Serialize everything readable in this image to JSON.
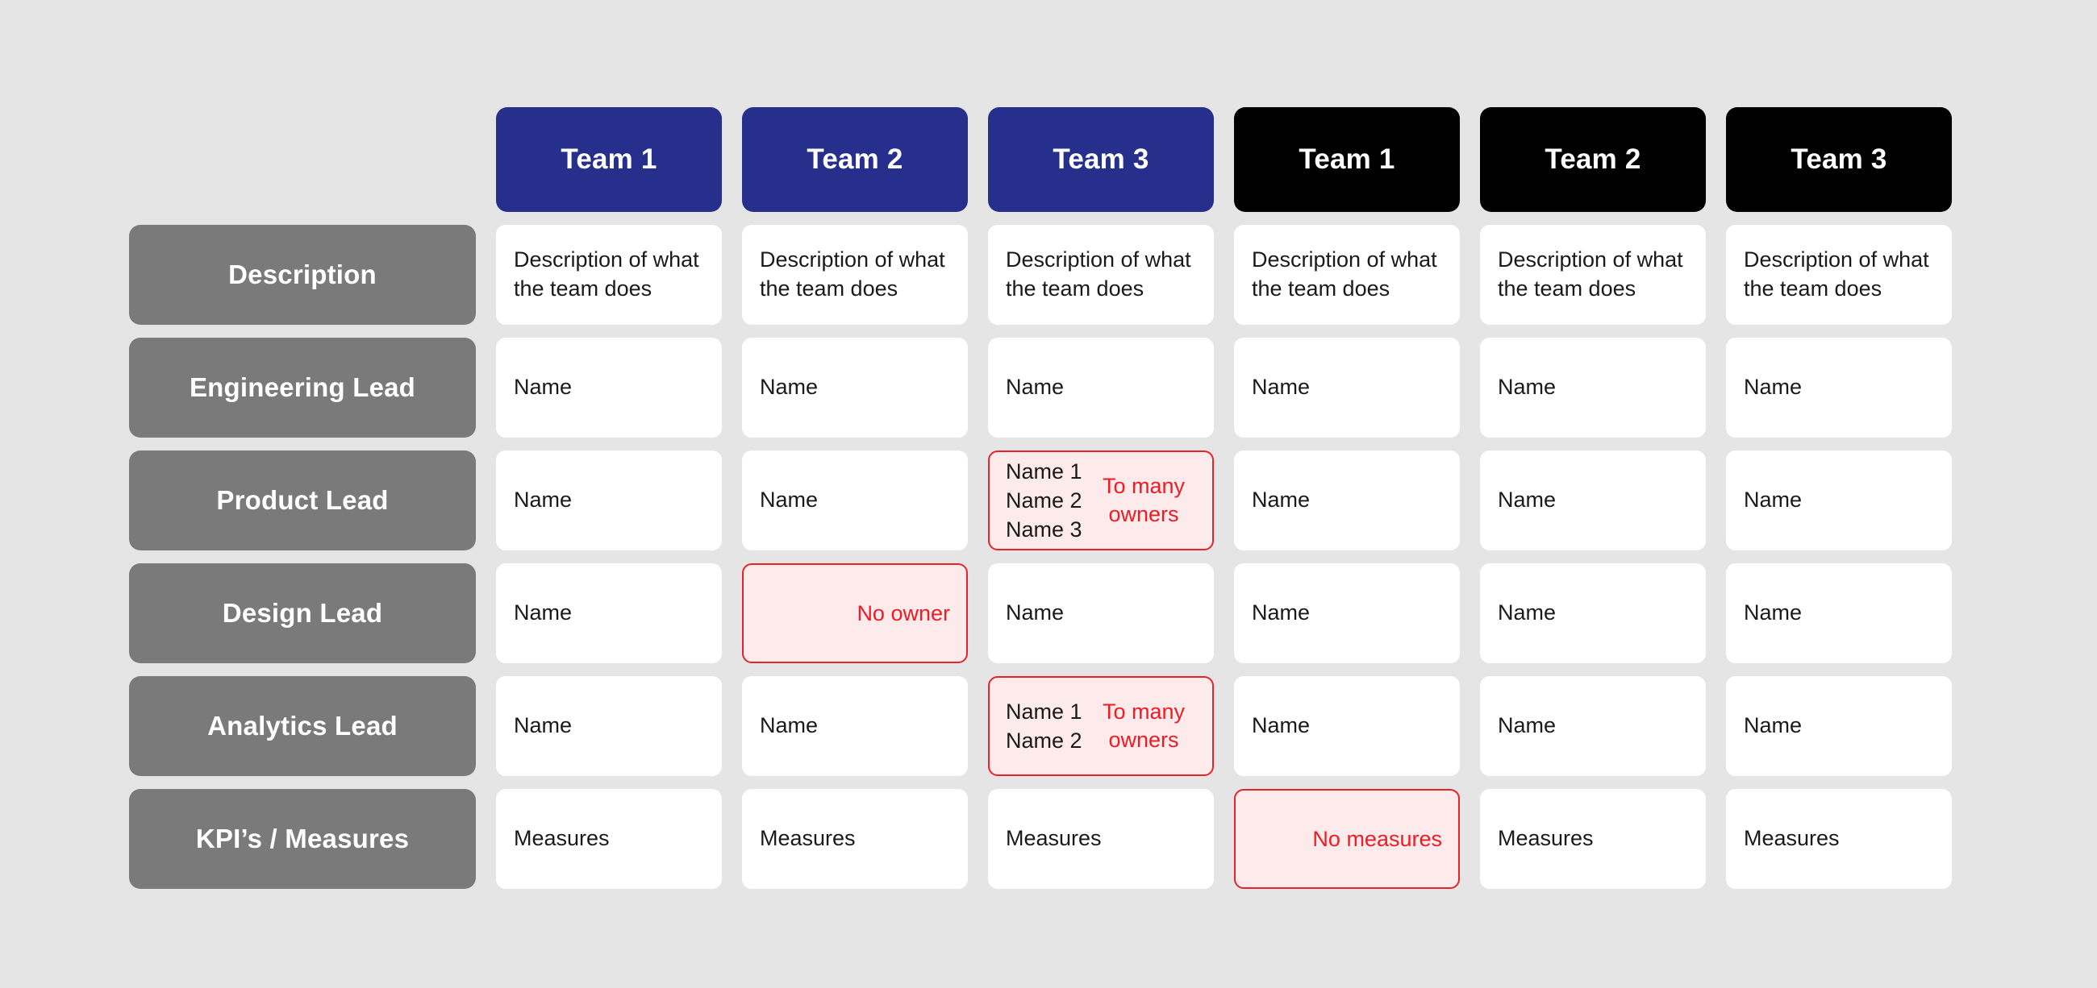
{
  "columns": [
    {
      "label": "Team 1",
      "style": "blue"
    },
    {
      "label": "Team 2",
      "style": "blue"
    },
    {
      "label": "Team 3",
      "style": "blue"
    },
    {
      "label": "Team 1",
      "style": "black"
    },
    {
      "label": "Team 2",
      "style": "black"
    },
    {
      "label": "Team 3",
      "style": "black"
    }
  ],
  "rows": [
    {
      "label": "Description",
      "cells": [
        {
          "text": "Description of what the team does",
          "state": "normal"
        },
        {
          "text": "Description of what the team does",
          "state": "normal"
        },
        {
          "text": "Description of what the team does",
          "state": "normal"
        },
        {
          "text": "Description of what the team does",
          "state": "normal"
        },
        {
          "text": "Description of what the team does",
          "state": "normal"
        },
        {
          "text": "Description of what the team does",
          "state": "normal"
        }
      ]
    },
    {
      "label": "Engineering Lead",
      "cells": [
        {
          "text": "Name",
          "state": "normal"
        },
        {
          "text": "Name",
          "state": "normal"
        },
        {
          "text": "Name",
          "state": "normal"
        },
        {
          "text": "Name",
          "state": "normal"
        },
        {
          "text": "Name",
          "state": "normal"
        },
        {
          "text": "Name",
          "state": "normal"
        }
      ]
    },
    {
      "label": "Product Lead",
      "cells": [
        {
          "text": "Name",
          "state": "normal"
        },
        {
          "text": "Name",
          "state": "normal"
        },
        {
          "text": "Name 1\nName 2\nName 3",
          "alert": "To many owners",
          "state": "alert-names"
        },
        {
          "text": "Name",
          "state": "normal"
        },
        {
          "text": "Name",
          "state": "normal"
        },
        {
          "text": "Name",
          "state": "normal"
        }
      ]
    },
    {
      "label": "Design Lead",
      "cells": [
        {
          "text": "Name",
          "state": "normal"
        },
        {
          "text": "",
          "alert": "No owner",
          "state": "alert-empty"
        },
        {
          "text": "Name",
          "state": "normal"
        },
        {
          "text": "Name",
          "state": "normal"
        },
        {
          "text": "Name",
          "state": "normal"
        },
        {
          "text": "Name",
          "state": "normal"
        }
      ]
    },
    {
      "label": "Analytics Lead",
      "cells": [
        {
          "text": "Name",
          "state": "normal"
        },
        {
          "text": "Name",
          "state": "normal"
        },
        {
          "text": "Name 1\nName 2",
          "alert": "To many owners",
          "state": "alert-names"
        },
        {
          "text": "Name",
          "state": "normal"
        },
        {
          "text": "Name",
          "state": "normal"
        },
        {
          "text": "Name",
          "state": "normal"
        }
      ]
    },
    {
      "label": "KPI’s / Measures",
      "cells": [
        {
          "text": "Measures",
          "state": "normal"
        },
        {
          "text": "Measures",
          "state": "normal"
        },
        {
          "text": "Measures",
          "state": "normal"
        },
        {
          "text": "",
          "alert": "No measures",
          "state": "alert-empty"
        },
        {
          "text": "Measures",
          "state": "normal"
        },
        {
          "text": "Measures",
          "state": "normal"
        }
      ]
    }
  ],
  "colors": {
    "background": "#e5e5e5",
    "header_blue": "#26308c",
    "header_black": "#000000",
    "row_header_gray": "#7a7a7a",
    "cell_white": "#ffffff",
    "alert_border": "#e8222a",
    "alert_fill": "#fdeaea",
    "alert_text": "#ee1c25"
  }
}
